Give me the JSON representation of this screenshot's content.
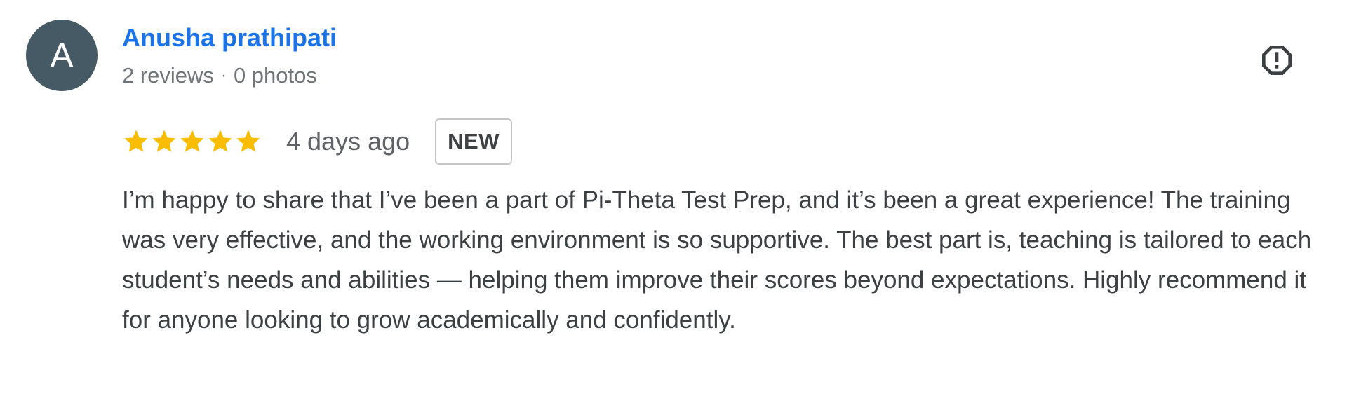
{
  "review": {
    "avatar_letter": "A",
    "avatar_color": "#455a64",
    "reviewer_name": "Anusha prathipati",
    "reviews_count": "2 reviews",
    "meta_separator": "·",
    "photos_count": "0 photos",
    "rating": 5,
    "rating_max": 5,
    "time_ago": "4 days ago",
    "badge": "NEW",
    "text": "I’m happy to share that I’ve been a part of Pi-Theta Test Prep, and it’s been a great experience! The training was very effective, and the working environment is so supportive. The best part is, teaching is tailored to each student’s needs and abilities — helping them improve their scores beyond expectations. Highly recommend it for anyone looking to grow academically and confidently.",
    "report_icon": "report-icon"
  },
  "colors": {
    "name_link": "#1a73e8",
    "star": "#fbbc04",
    "meta_text": "#70757a",
    "body_text": "#3c4043"
  }
}
